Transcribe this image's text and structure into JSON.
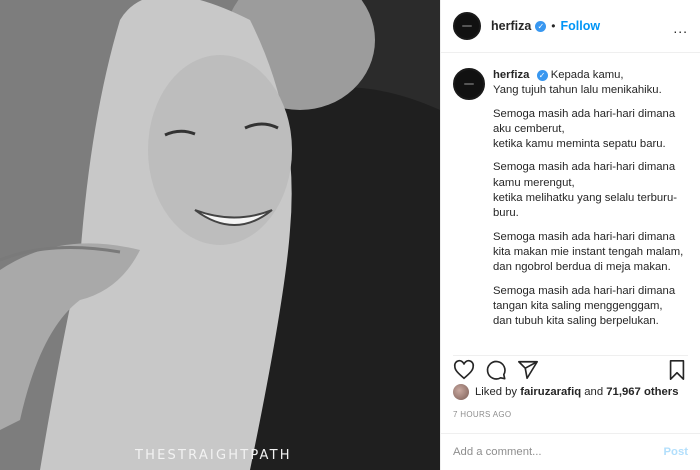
{
  "photo": {
    "alt": "",
    "watermark": "THESTRAIGHTPATH"
  },
  "header": {
    "username": "herfiza",
    "separator": "•",
    "follow_label": "Follow",
    "more_label": "..."
  },
  "caption": {
    "username": "herfiza",
    "paragraphs": [
      "Kepada kamu,\nYang tujuh tahun lalu menikahiku.",
      "Semoga masih ada hari-hari dimana aku cemberut,\nketika kamu meminta sepatu baru.",
      "Semoga masih ada hari-hari dimana kamu merengut,\nketika melihatku yang selalu terburu-buru.",
      "Semoga masih ada hari-hari dimana kita makan mie instant tengah malam,\ndan ngobrol berdua di meja makan.",
      "Semoga masih ada hari-hari dimana tangan kita saling menggenggam,\ndan tubuh kita saling berpelukan."
    ]
  },
  "likes": {
    "prefix": "Liked by",
    "user": "fairuzarafiq",
    "middle": "and",
    "count": "71,967 others"
  },
  "timestamp": "7 HOURS AGO",
  "comment": {
    "placeholder": "Add a comment...",
    "post_label": "Post"
  },
  "colors": {
    "accent": "#0095f6",
    "verified": "#3897f0",
    "post_disabled": "#b2dffc"
  }
}
